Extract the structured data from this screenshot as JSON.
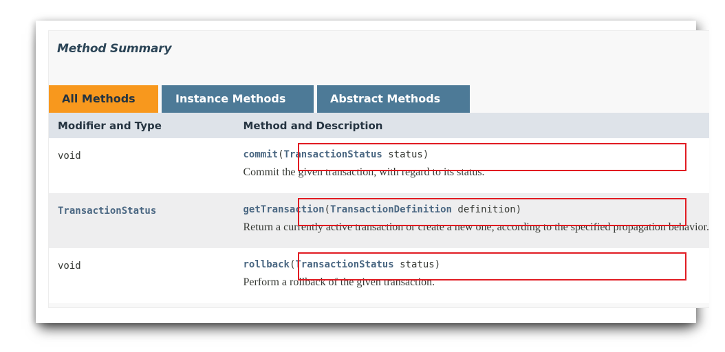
{
  "method_summary": {
    "title": "Method Summary",
    "tabs": [
      {
        "label": "All Methods",
        "active": true
      },
      {
        "label": "Instance Methods",
        "active": false
      },
      {
        "label": "Abstract Methods",
        "active": false
      }
    ],
    "columns": {
      "modifier_and_type": "Modifier and Type",
      "method_and_description": "Method and Description"
    },
    "rows": [
      {
        "modifier_type": "void",
        "method_name": "commit",
        "open_paren": "(",
        "param_type": "TransactionStatus",
        "param_name": " status",
        "close_paren": ")",
        "description": "Commit the given transaction, with regard to its status."
      },
      {
        "modifier_type": "TransactionStatus",
        "method_name": "getTransaction",
        "open_paren": "(",
        "param_type": "TransactionDefinition",
        "param_name": " definition",
        "close_paren": ")",
        "description": "Return a currently active transaction or create a new one, according to the specified propagation behavior."
      },
      {
        "modifier_type": "void",
        "method_name": "rollback",
        "open_paren": "(",
        "param_type": "TransactionStatus",
        "param_name": " status",
        "close_paren": ")",
        "description": "Perform a rollback of the given transaction."
      }
    ]
  },
  "colors": {
    "active_tab": "#f8981d",
    "inactive_tab": "#4d7a97",
    "header_row": "#dee3e9",
    "link": "#4a6782",
    "highlight_box": "#e11b22"
  }
}
